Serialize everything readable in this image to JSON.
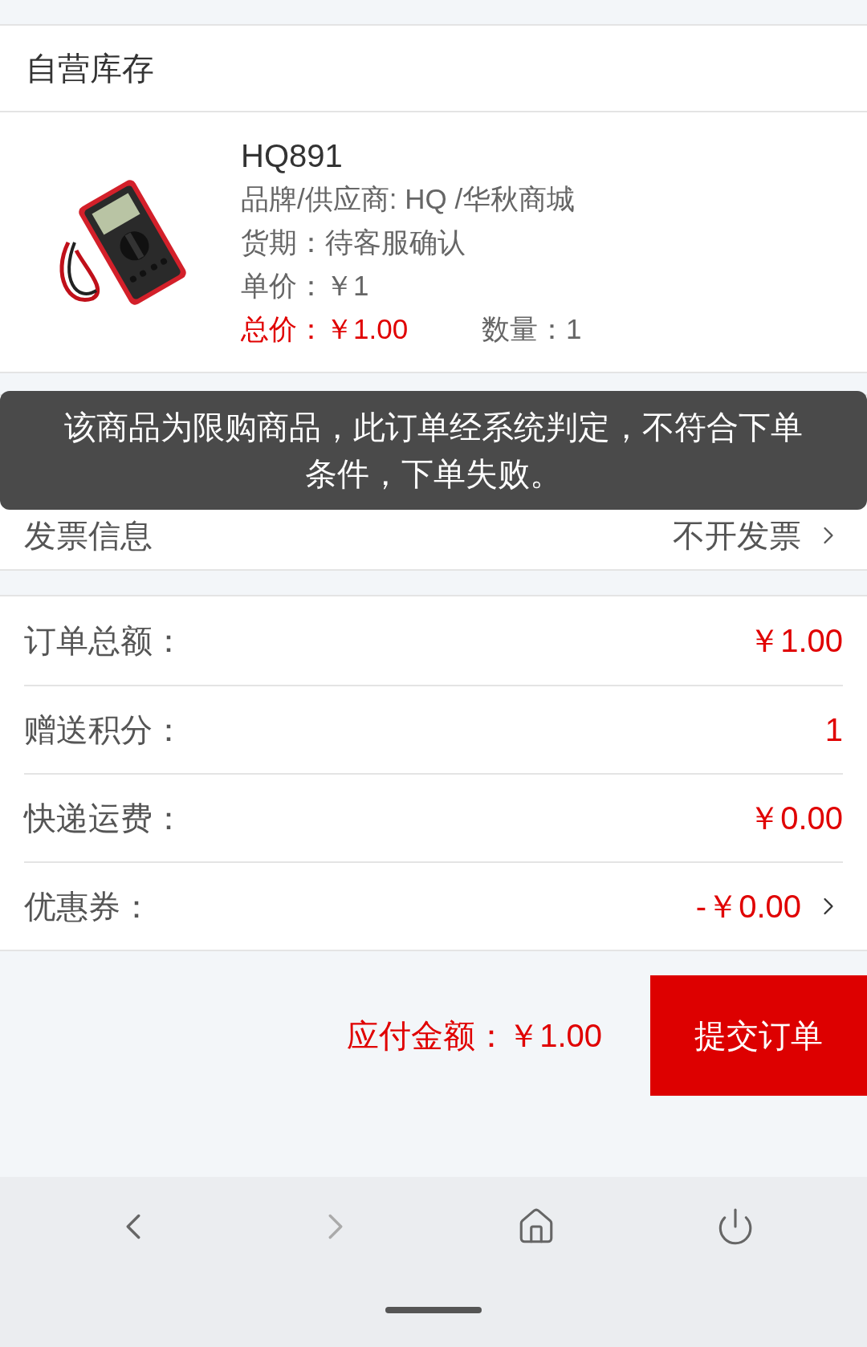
{
  "section_title": "自营库存",
  "product": {
    "kind": "picture",
    "name": "HQ891",
    "brand": "品牌/供应商: HQ /华秋商城",
    "delivery": "货期：待客服确认",
    "unit_price": "单价：￥1",
    "total_price": "总价：￥1.00",
    "quantity": "数量：1"
  },
  "options": [
    {
      "label": "发票信息",
      "value": "不开发票"
    }
  ],
  "summary": [
    {
      "label": "订单总额：",
      "value": "￥1.00",
      "has_arrow": false
    },
    {
      "label": "赠送积分：",
      "value": "1",
      "has_arrow": false
    },
    {
      "label": "快递运费：",
      "value": "￥0.00",
      "has_arrow": false
    },
    {
      "label": "优惠券：",
      "value": "-￥0.00",
      "has_arrow": true
    }
  ],
  "footer": {
    "amount_due": "应付金额：￥1.00",
    "submit": "提交订单"
  },
  "toast": "该商品为限购商品，此订单经系统判定，不符合下单条件，下单失败。"
}
